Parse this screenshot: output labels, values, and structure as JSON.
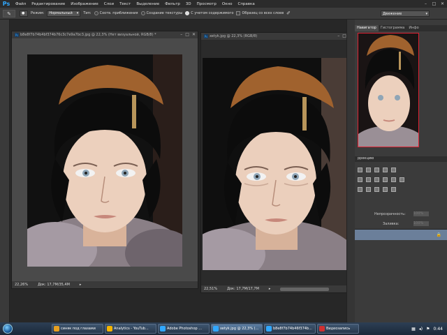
{
  "app": {
    "logo": "Ps"
  },
  "menu": [
    "Файл",
    "Редактирование",
    "Изображение",
    "Слои",
    "Текст",
    "Выделение",
    "Фильтр",
    "3D",
    "Просмотр",
    "Окно",
    "Справка"
  ],
  "window_controls": {
    "minimize": "–",
    "maximize": "□",
    "close": "✕"
  },
  "options_bar": {
    "tool_icon": "healing-brush-icon",
    "mode_label": "Режим:",
    "mode_value": "Нормальный",
    "type_label": "Тип:",
    "radio1": "Соотв. приближения",
    "radio2": "Создание текстуры",
    "radio3": "С учетом содержимого",
    "sample_all": "Образец со всех слоев",
    "workspace": "Движение"
  },
  "doc1": {
    "title": "b8e8f7b74b4bf374b76c3c7e9a7bc3.jpg @ 22,3% (Нет визуальной, RGB/8) *",
    "zoom": "22,26%",
    "doc_size": "Док: 17,7M/35,4M"
  },
  "doc2": {
    "title": "xetyk.jpg @ 22,3% (RGB/8)",
    "zoom": "22,51%",
    "doc_size": "Док: 17,7M/17,7M"
  },
  "panels": {
    "tabs": [
      "Навигатор",
      "Гистограмма",
      "Инфо"
    ],
    "adjustments_label": "ррекцию",
    "layers_opacity_label": "Непрозрачность:",
    "layers_fill_label": "Заливка:",
    "opacity_value": "100%",
    "fill_value": "100%"
  },
  "taskbar": {
    "items": [
      {
        "label": "синяк под глазами",
        "icon": "#e8a020"
      },
      {
        "label": "Analytics - YouTub...",
        "icon": "#f4b400"
      },
      {
        "label": "Adobe Photoshop ...",
        "icon": "#31a8ff"
      },
      {
        "label": "xetyk.jpg @ 22,3% (...",
        "icon": "#31a8ff"
      },
      {
        "label": "b8e8f7b74b46f374b...",
        "icon": "#31a8ff"
      },
      {
        "label": "Видеозапись",
        "icon": "#d03030"
      }
    ],
    "clock": "0:44"
  }
}
